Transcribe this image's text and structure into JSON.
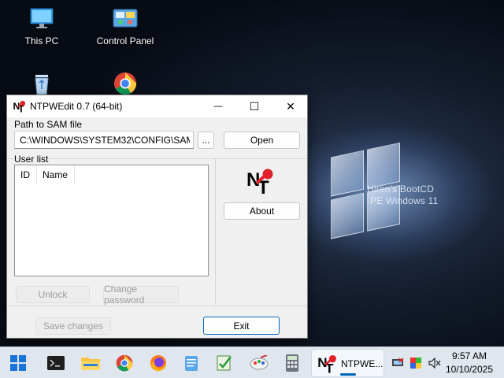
{
  "desktop": {
    "icons": [
      {
        "label": "This PC",
        "icon": "monitor-icon"
      },
      {
        "label": "Control Panel",
        "icon": "control-panel-icon"
      },
      {
        "label": "",
        "icon": "recycle-bin-icon"
      },
      {
        "label": "",
        "icon": "chrome-icon"
      }
    ],
    "wallpaper_text": {
      "line1": "Hiren's BootCD",
      "line2": "PE Windows 11"
    }
  },
  "window": {
    "title": "NTPWEdit 0.7 (64-bit)",
    "controls": {
      "minimize": "—",
      "maximize": "☐",
      "close": "✕"
    },
    "path_label": "Path to SAM file",
    "path_value": "C:\\WINDOWS\\SYSTEM32\\CONFIG\\SAM",
    "browse_label": "...",
    "open_label": "Open",
    "user_list_label": "User list",
    "columns": [
      "ID",
      "Name"
    ],
    "users": [],
    "about_label": "About",
    "unlock_label": "Unlock",
    "change_password_label": "Change password",
    "save_changes_label": "Save changes",
    "exit_label": "Exit"
  },
  "taskbar": {
    "items": [
      "start-icon",
      "terminal-icon",
      "file-explorer-icon",
      "chrome-icon",
      "firefox-icon",
      "notepad-icon",
      "registry-editor-icon",
      "paint-icon",
      "calculator-icon"
    ],
    "active_app": {
      "label": "NTPWE...",
      "icon": "ntpwedit-icon"
    },
    "tray": [
      "network-icon",
      "color-icon",
      "volume-muted-icon"
    ],
    "time": "9:57 AM",
    "date": "10/10/2025"
  },
  "colors": {
    "accent": "#0067c0",
    "nt_red": "#e0202a"
  }
}
